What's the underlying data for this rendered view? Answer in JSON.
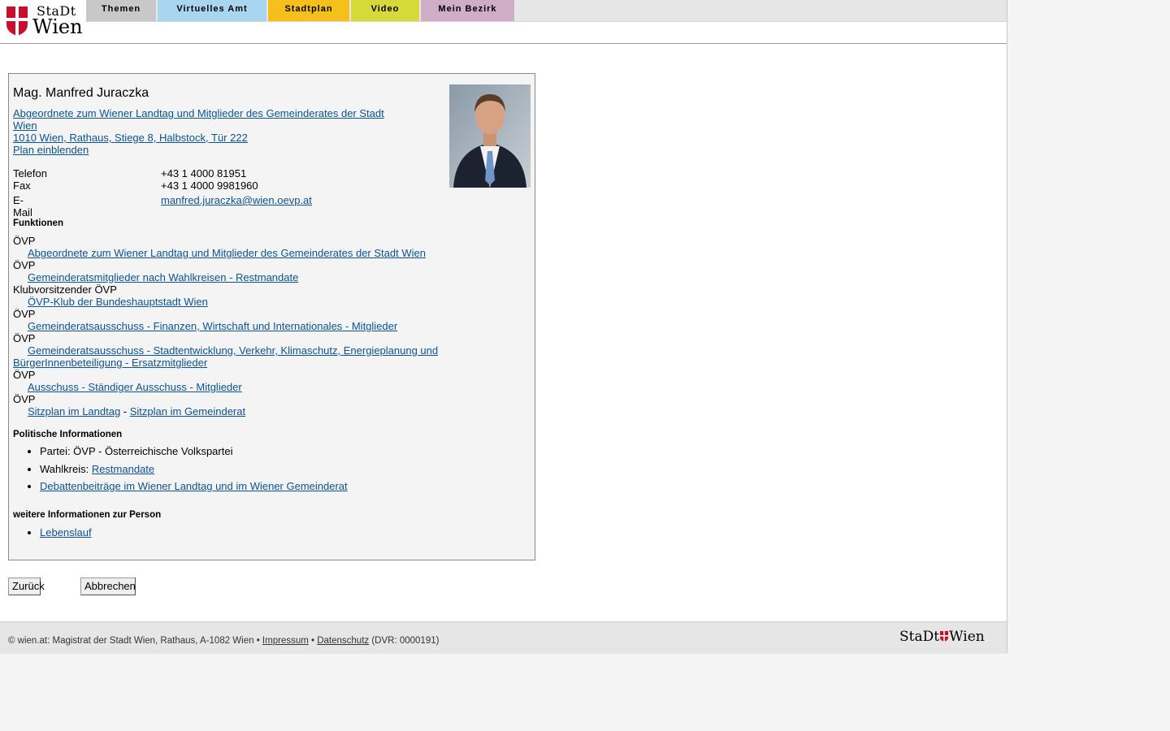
{
  "header": {
    "logo_top": "StaDt",
    "logo_bottom": "Wien",
    "tabs": [
      "Themen",
      "Virtuelles Amt",
      "Stadtplan",
      "Video",
      "Mein Bezirk"
    ]
  },
  "person": {
    "name": "Mag. Manfred Juraczka",
    "role_link": "Abgeordnete zum Wiener Landtag und Mitglieder des Gemeinderates der Stadt Wien",
    "address_link": "1010 Wien, Rathaus, Stiege 8, Halbstock, Tür 222",
    "plan_link": "Plan einblenden",
    "contact": {
      "phone_label": "Telefon",
      "phone": "+43 1 4000 81951",
      "fax_label": "Fax",
      "fax": "+43 1 4000 9981960",
      "email_label": "E-Mail",
      "email": "manfred.juraczka@wien.oevp.at"
    }
  },
  "functions": {
    "heading": "Funktionen",
    "items": [
      {
        "role": "ÖVP",
        "link": "Abgeordnete zum Wiener Landtag und Mitglieder des Gemeinderates der Stadt Wien"
      },
      {
        "role": "ÖVP",
        "link": "Gemeinderatsmitglieder nach Wahlkreisen - Restmandate"
      },
      {
        "role": "Klubvorsitzender ÖVP",
        "link": "ÖVP-Klub der Bundeshauptstadt Wien"
      },
      {
        "role": "ÖVP",
        "link": "Gemeinderatsausschuss - Finanzen, Wirtschaft und Internationales - Mitglieder"
      },
      {
        "role": "ÖVP",
        "link": "Gemeinderatsausschuss - Stadtentwicklung, Verkehr, Klimaschutz, Energieplanung und BürgerInnenbeteiligung - Ersatzmitglieder"
      },
      {
        "role": "ÖVP",
        "link": "Ausschuss - Ständiger Ausschuss - Mitglieder"
      },
      {
        "role": "ÖVP",
        "link_a": "Sitzplan im Landtag",
        "sep": " - ",
        "link_b": "Sitzplan im Gemeinderat"
      }
    ]
  },
  "political": {
    "heading": "Politische Informationen",
    "party": "Partei: ÖVP - Österreichische Volkspartei",
    "district_label": "Wahlkreis: ",
    "district_link": "Restmandate",
    "debates_link": "Debattenbeiträge im Wiener Landtag und im Wiener Gemeinderat"
  },
  "more": {
    "heading": "weitere Informationen zur Person",
    "cv_link": "Lebenslauf"
  },
  "buttons": {
    "back": "Zurück",
    "cancel": "Abbrechen"
  },
  "footer": {
    "prefix": "© wien.at: Magistrat der Stadt Wien, Rathaus, A-1082 Wien • ",
    "impressum": "Impressum",
    "bullet": " • ",
    "datenschutz": "Datenschutz",
    "dvr": " (DVR: 0000191)",
    "logo_left": "StaDt",
    "logo_right": "Wien"
  },
  "colors": {
    "link": "#0b5394",
    "tab_themen": "#c8c8c8",
    "tab_virtuelles_amt": "#a9d5ef",
    "tab_stadtplan": "#f5bf1c",
    "tab_video": "#d6d93a",
    "tab_mein_bezirk": "#cfadc6",
    "wien_red": "#c8102e"
  }
}
